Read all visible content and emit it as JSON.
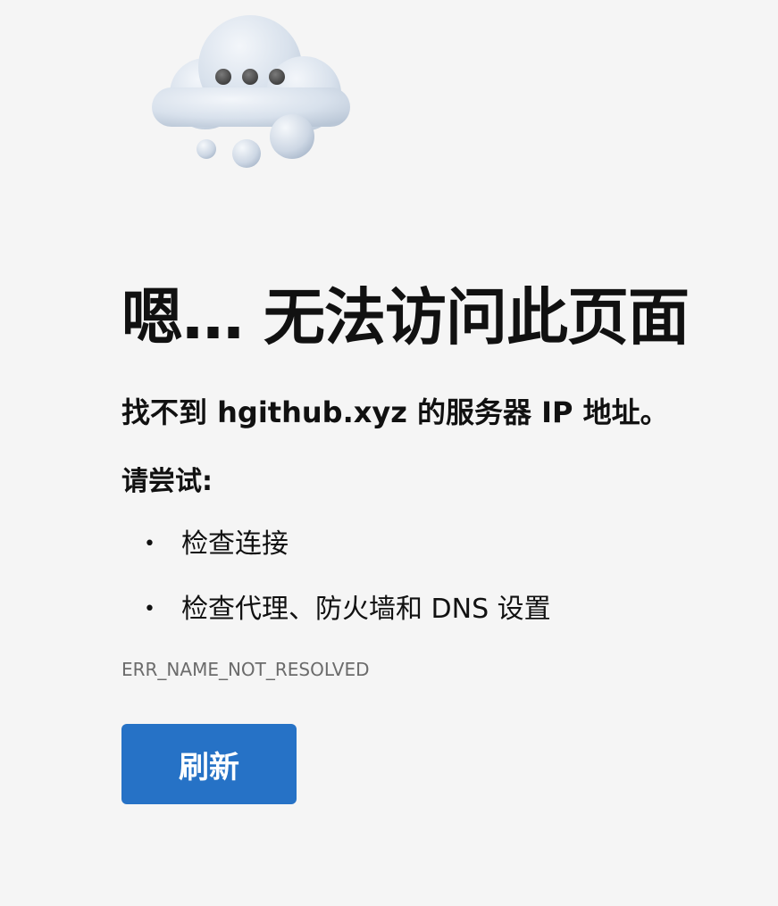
{
  "illustration": {
    "icon": "thinking-cloud-icon"
  },
  "error_page": {
    "headline": "嗯… 无法访问此页面",
    "summary": "找不到 hgithub.xyz 的服务器 IP 地址。",
    "try_label": "请尝试:",
    "suggestions": [
      {
        "bullet": "•",
        "text": "检查连接"
      },
      {
        "bullet": "•",
        "text": "检查代理、防火墙和 DNS 设置"
      }
    ],
    "error_code": "ERR_NAME_NOT_RESOLVED",
    "refresh_label": "刷新"
  },
  "colors": {
    "background": "#f5f5f5",
    "button": "#2672c6",
    "button_text": "#ffffff",
    "error_code_text": "#6b6b6b"
  }
}
